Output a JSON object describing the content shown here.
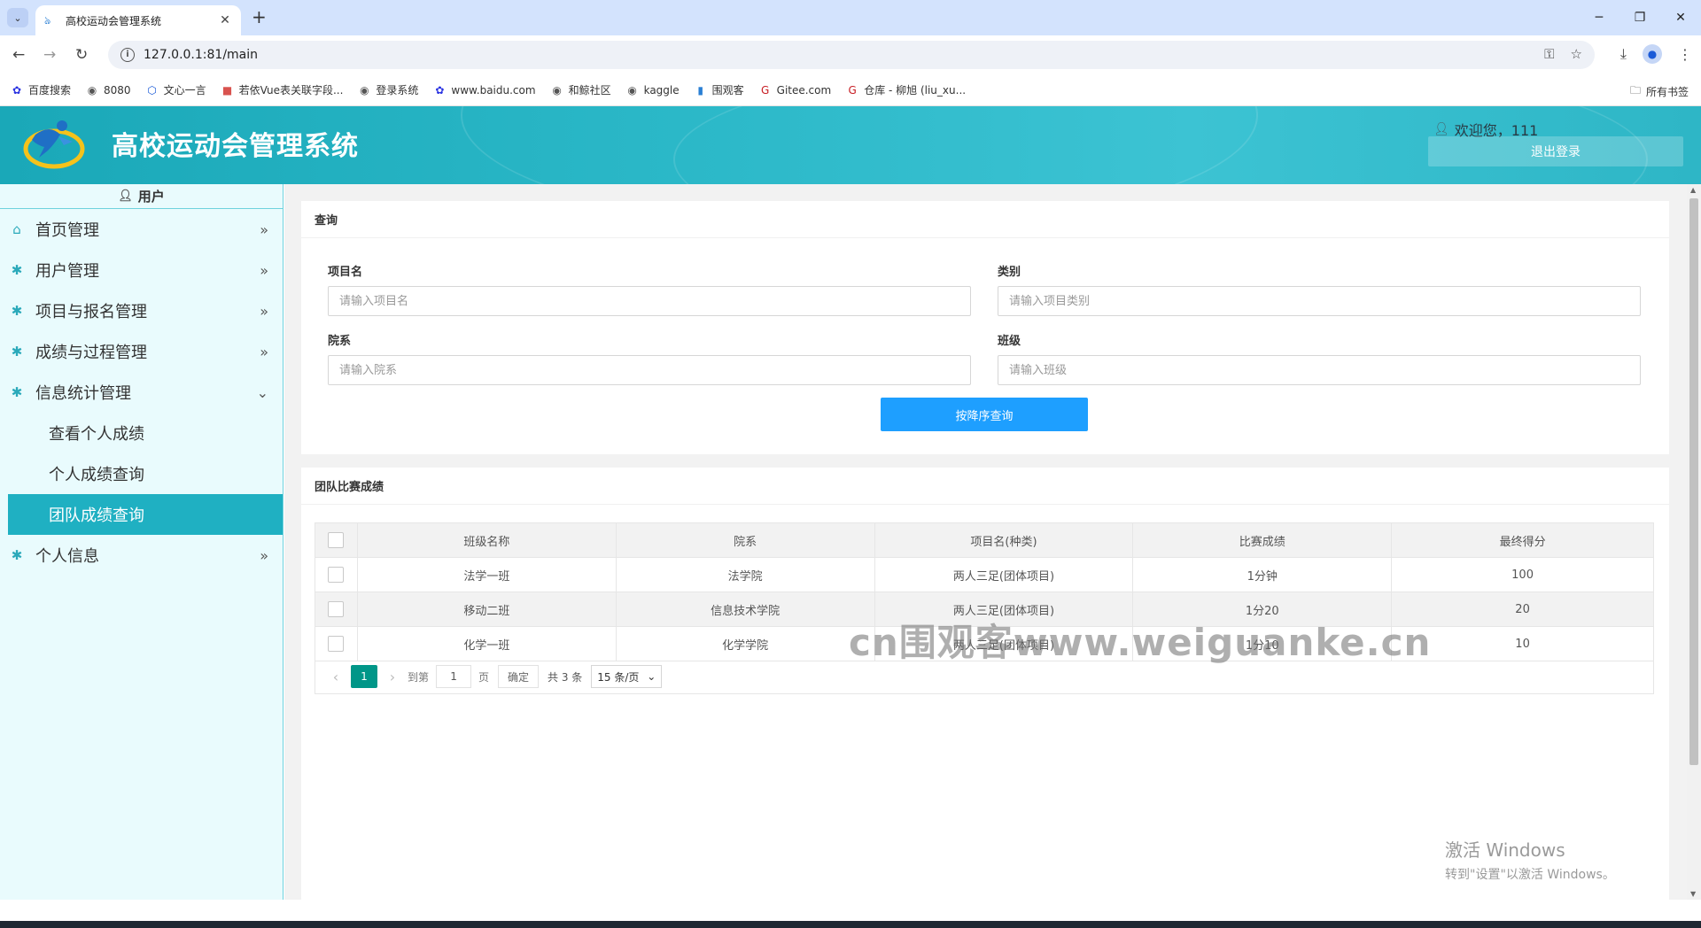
{
  "browser": {
    "tab_title": "高校运动会管理系统",
    "url": "127.0.0.1:81/main",
    "bookmarks": [
      {
        "label": "百度搜索",
        "icon": "paw-icon",
        "color": "#2932e1"
      },
      {
        "label": "8080",
        "icon": "globe-icon",
        "color": "#555555"
      },
      {
        "label": "文心一言",
        "icon": "wenxin-icon",
        "color": "#1a5ad7"
      },
      {
        "label": "若依Vue表关联字段...",
        "icon": "ruoyi-icon",
        "color": "#d9534f"
      },
      {
        "label": "登录系统",
        "icon": "globe-icon",
        "color": "#555555"
      },
      {
        "label": "www.baidu.com",
        "icon": "paw-icon",
        "color": "#2932e1"
      },
      {
        "label": "和鲸社区",
        "icon": "globe-icon",
        "color": "#555555"
      },
      {
        "label": "kaggle",
        "icon": "globe-icon",
        "color": "#555555"
      },
      {
        "label": "围观客",
        "icon": "bar-icon",
        "color": "#2a7fd4"
      },
      {
        "label": "Gitee.com",
        "icon": "gitee-icon",
        "color": "#c71d23"
      },
      {
        "label": "仓库 - 柳旭 (liu_xu...",
        "icon": "gitee-icon",
        "color": "#c71d23"
      }
    ],
    "all_bookmarks": "所有书签"
  },
  "header": {
    "title": "高校运动会管理系统",
    "welcome": "欢迎您，111",
    "logout": "退出登录"
  },
  "sidebar": {
    "head": "用户",
    "items": [
      {
        "label": "首页管理",
        "icon": "home-icon",
        "arrow": "»"
      },
      {
        "label": "用户管理",
        "icon": "gear-icon",
        "arrow": "»"
      },
      {
        "label": "项目与报名管理",
        "icon": "gear-icon",
        "arrow": "»"
      },
      {
        "label": "成绩与过程管理",
        "icon": "gear-icon",
        "arrow": "»"
      },
      {
        "label": "信息统计管理",
        "icon": "gear-icon",
        "arrow": "⌄"
      }
    ],
    "sub_items": [
      "查看个人成绩",
      "个人成绩查询",
      "团队成绩查询"
    ],
    "last_item": {
      "label": "个人信息",
      "icon": "gear-icon",
      "arrow": "»"
    }
  },
  "query": {
    "title": "查询",
    "fields": [
      {
        "label": "项目名",
        "placeholder": "请输入项目名"
      },
      {
        "label": "类别",
        "placeholder": "请输入项目类别"
      },
      {
        "label": "院系",
        "placeholder": "请输入院系"
      },
      {
        "label": "班级",
        "placeholder": "请输入班级"
      }
    ],
    "button": "按降序查询"
  },
  "results": {
    "title": "团队比赛成绩",
    "columns": [
      "班级名称",
      "院系",
      "项目名(种类)",
      "比赛成绩",
      "最终得分"
    ],
    "rows": [
      [
        "法学一班",
        "法学院",
        "两人三足(团体项目)",
        "1分钟",
        "100"
      ],
      [
        "移动二班",
        "信息技术学院",
        "两人三足(团体项目)",
        "1分20",
        "20"
      ],
      [
        "化学一班",
        "化学学院",
        "两人三足(团体项目)",
        "1分10",
        "10"
      ]
    ]
  },
  "pager": {
    "current": "1",
    "goto_label": "到第",
    "goto_value": "1",
    "page_unit": "页",
    "confirm": "确定",
    "total": "共 3 条",
    "page_size": "15 条/页"
  },
  "watermark": "cn围观客www.weiguanke.cn",
  "windows_activation": {
    "line1": "激活 Windows",
    "line2": "转到\"设置\"以激活 Windows。"
  }
}
